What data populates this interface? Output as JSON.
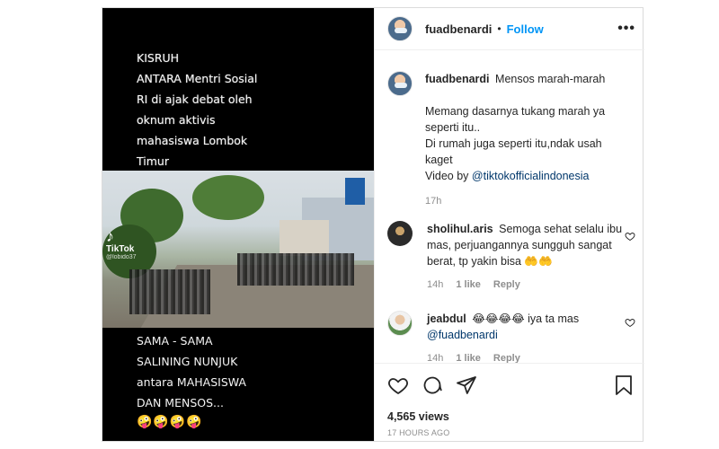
{
  "media": {
    "top_lines": [
      "KISRUH",
      "ANTARA Mentri Sosial",
      "RI di ajak debat oleh",
      "oknum aktivis",
      "mahasiswa Lombok",
      "Timur"
    ],
    "bottom_lines": [
      "SAMA - SAMA",
      "SALINING NUNJUK",
      "antara MAHASISWA",
      "DAN MENSOS..."
    ],
    "emojis": "🤪🤪🤪🤪",
    "tiktok_label": "TikTok",
    "tiktok_handle": "@lobido37"
  },
  "header": {
    "username": "fuadbenardi",
    "separator": "•",
    "follow_label": "Follow",
    "more_label": "•••"
  },
  "caption": {
    "username": "fuadbenardi",
    "text_first": "Mensos marah-marah",
    "line2": "Memang dasarnya tukang marah ya seperti itu..",
    "line3": "Di rumah juga seperti itu,ndak usah kaget",
    "video_by": "Video by ",
    "mention": "@tiktokofficialindonesia",
    "time": "17h"
  },
  "comments": [
    {
      "username": "sholihul.aris",
      "text": "Semoga sehat selalu ibu mas, perjuangannya sungguh sangat berat, tp yakin bisa 🤲🤲",
      "time": "14h",
      "likes": "1 like",
      "reply": "Reply"
    },
    {
      "username": "jeabdul",
      "text": "😂😂😂😂 iya ta mas ",
      "mention": "@fuadbenardi",
      "time": "14h",
      "likes": "1 like",
      "reply": "Reply"
    }
  ],
  "footer": {
    "views": "4,565 views",
    "timestamp": "17 HOURS AGO"
  },
  "icons": [
    "heart-icon",
    "comment-icon",
    "share-icon",
    "bookmark-icon",
    "more-icon"
  ],
  "colors": {
    "follow": "#0095f6",
    "link": "#00376b",
    "muted": "#8e8e8e"
  }
}
